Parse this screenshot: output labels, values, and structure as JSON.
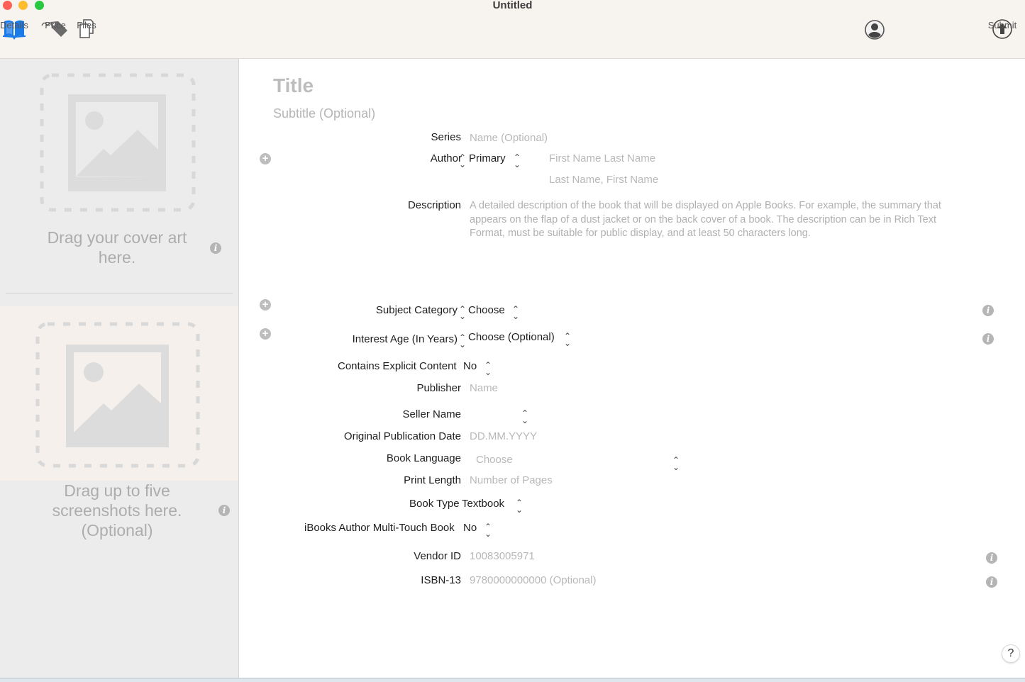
{
  "window": {
    "title": "Untitled"
  },
  "toolbar": {
    "items": [
      {
        "label": "Details",
        "icon": "book-open-icon",
        "active": true
      },
      {
        "label": "Price",
        "icon": "price-tag-icon"
      },
      {
        "label": "Files",
        "icon": "files-icon"
      }
    ],
    "account_icon": "account-icon",
    "submit_label": "Submit"
  },
  "sidebar": {
    "cover_text": "Drag your cover art here.",
    "screenshots_text": "Drag up to five screenshots here. (Optional)"
  },
  "form": {
    "title_placeholder": "Title",
    "subtitle_placeholder": "Subtitle (Optional)",
    "series": {
      "label": "Series",
      "placeholder": "Name (Optional)"
    },
    "author": {
      "label": "Author",
      "role": "Primary",
      "name_placeholder": "First Name Last Name",
      "sort_placeholder": "Last Name, First Name"
    },
    "description": {
      "label": "Description",
      "placeholder": "A detailed description of the book that will be displayed on Apple Books. For example, the summary that appears on the flap of a dust jacket or on the back cover of a book. The description can be in Rich Text Format, must be suitable for public display, and at least 50 characters long."
    },
    "subject_category": {
      "label": "Subject Category",
      "value": "Choose"
    },
    "interest_age": {
      "label": "Interest Age (In Years)",
      "value": "Choose (Optional)"
    },
    "explicit": {
      "label": "Contains Explicit Content",
      "value": "No"
    },
    "publisher": {
      "label": "Publisher",
      "placeholder": "Name"
    },
    "seller": {
      "label": "Seller Name",
      "value": ""
    },
    "pub_date": {
      "label": "Original Publication Date",
      "placeholder": "DD.MM.YYYY"
    },
    "language": {
      "label": "Book Language",
      "value": "Choose"
    },
    "print_length": {
      "label": "Print Length",
      "placeholder": "Number of Pages"
    },
    "book_type": {
      "label": "Book Type",
      "value": "Textbook"
    },
    "multitouch": {
      "label": "iBooks Author Multi-Touch Book",
      "value": "No"
    },
    "vendor_id": {
      "label": "Vendor ID",
      "placeholder": "10083005971"
    },
    "isbn": {
      "label": "ISBN-13",
      "placeholder": "9780000000000 (Optional)"
    }
  },
  "help_label": "?"
}
